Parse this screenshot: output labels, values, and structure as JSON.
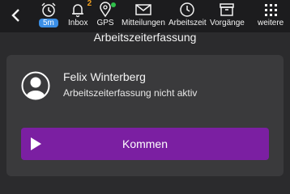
{
  "toolbar": {
    "items": [
      {
        "id": "timer",
        "icon": "alarm-clock-icon",
        "label": "5m"
      },
      {
        "id": "inbox",
        "icon": "bell-icon",
        "label": "Inbox",
        "badge": "2"
      },
      {
        "id": "gps",
        "icon": "location-pin-icon",
        "label": "GPS",
        "status_color": "#2fbf4a"
      },
      {
        "id": "mitteilungen",
        "icon": "envelope-icon",
        "label": "Mitteilungen"
      },
      {
        "id": "arbeitszeit",
        "icon": "clock-icon",
        "label": "Arbeitszeit"
      },
      {
        "id": "vorgaenge",
        "icon": "archive-box-icon",
        "label": "Vorgänge"
      },
      {
        "id": "weitere",
        "icon": "grid-dots-icon",
        "label": "weitere"
      }
    ]
  },
  "page": {
    "title": "Arbeitszeiterfassung"
  },
  "user": {
    "name": "Felix Winterberg",
    "status": "Arbeitszeiterfassung nicht aktiv"
  },
  "action": {
    "label": "Kommen",
    "color": "#7b1fa2"
  }
}
